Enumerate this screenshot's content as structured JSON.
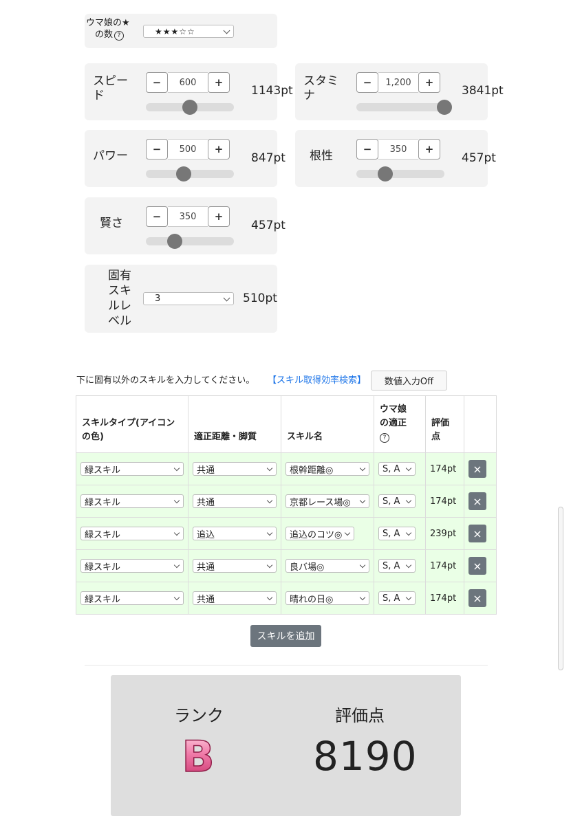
{
  "stars": {
    "label_line1": "ウマ娘の★",
    "label_line2": "の数",
    "help": "?",
    "value": "★★★☆☆"
  },
  "stats": [
    {
      "label_line1": "スピー",
      "label_line2": "ド",
      "value": "600",
      "points": "1143pt",
      "slider_fraction": 0.5
    },
    {
      "label_line1": "スタミ",
      "label_line2": "ナ",
      "value": "1,200",
      "points": "3841pt",
      "slider_fraction": 1.0
    },
    {
      "label_line1": "パワー",
      "label_line2": "",
      "value": "500",
      "points": "847pt",
      "slider_fraction": 0.43
    },
    {
      "label_line1": "根性",
      "label_line2": "",
      "value": "350",
      "points": "457pt",
      "slider_fraction": 0.33
    },
    {
      "label_line1": "賢さ",
      "label_line2": "",
      "value": "350",
      "points": "457pt",
      "slider_fraction": 0.33
    }
  ],
  "stepper": {
    "minus": "−",
    "plus": "+"
  },
  "unique_skill": {
    "label": [
      "固有",
      "スキ",
      "ルレ",
      "ベル"
    ],
    "value": "3",
    "points": "510pt"
  },
  "instructions": "下に固有以外のスキルを入力してください。",
  "search_link": "【スキル取得効率検索】",
  "numeric_toggle": "数値入力Off",
  "table": {
    "headers": {
      "type_line1": "スキルタイプ(アイコン",
      "type_line2": "の色)",
      "distance": "適正距離・脚質",
      "name": "スキル名",
      "apt_line1": "ウマ娘",
      "apt_line2": "の適正",
      "apt_help": "?",
      "score_line1": "評価",
      "score_line2": "点"
    },
    "rows": [
      {
        "type": "緑スキル",
        "distance": "共通",
        "name": "根幹距離◎",
        "apt": "S, A",
        "score": "174pt"
      },
      {
        "type": "緑スキル",
        "distance": "共通",
        "name": "京都レース場◎",
        "apt": "S, A",
        "score": "174pt"
      },
      {
        "type": "緑スキル",
        "distance": "追込",
        "name": "追込のコツ◎",
        "apt": "S, A",
        "score": "239pt"
      },
      {
        "type": "緑スキル",
        "distance": "共通",
        "name": "良バ場◎",
        "apt": "S, A",
        "score": "174pt"
      },
      {
        "type": "緑スキル",
        "distance": "共通",
        "name": "晴れの日◎",
        "apt": "S, A",
        "score": "174pt"
      }
    ],
    "delete_glyph": "×"
  },
  "add_skill_button": "スキルを追加",
  "result": {
    "rank_label": "ランク",
    "rank_value": "B",
    "score_label": "評価点",
    "score_value": "8190"
  },
  "colors": {
    "card_bg": "#f3f3f3",
    "row_bg": "#eaffe6",
    "link": "#1a73e8",
    "delete_btn": "#6c757d",
    "result_bg": "#dedede",
    "rank_pink": "#e8508a"
  }
}
